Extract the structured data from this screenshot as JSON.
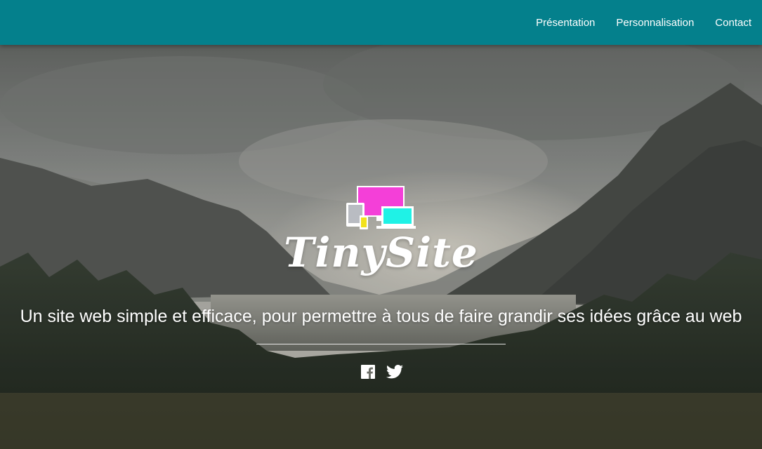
{
  "navbar": {
    "background_color": "#04808c",
    "links": [
      {
        "label": "Présentation"
      },
      {
        "label": "Personnalisation"
      },
      {
        "label": "Contact"
      }
    ]
  },
  "hero": {
    "brand": "TinySite",
    "tagline": "Un site web simple et efficace, pour permettre à tous de faire grandir ses idées grâce au web",
    "logo_colors": {
      "monitor": "#f43fd8",
      "tablet": "#b9bcc2",
      "phone": "#f2e21c",
      "laptop": "#1ff2e6"
    },
    "social_icons": [
      "facebook-icon",
      "twitter-icon"
    ]
  }
}
